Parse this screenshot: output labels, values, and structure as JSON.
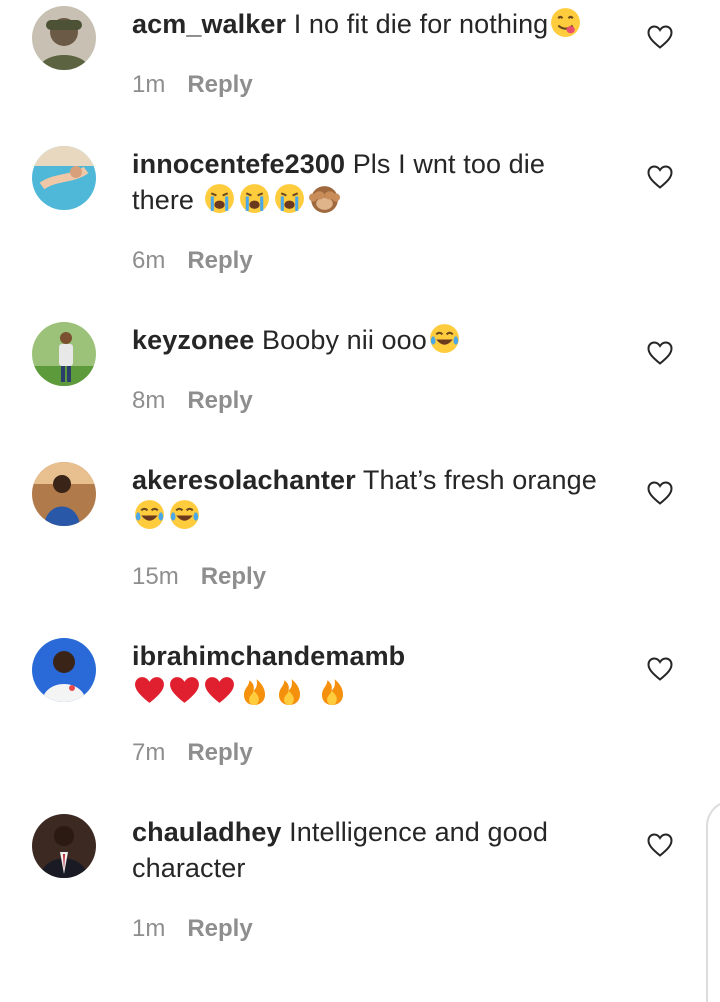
{
  "comments": [
    {
      "username": "acm_walker",
      "text": "I no fit die for nothing",
      "emojis": [
        "yum-emoji"
      ],
      "time": "1m",
      "reply_label": "Reply"
    },
    {
      "username": "innocentefe2300",
      "text": "Pls I wnt too die there",
      "emojis": [
        "loudly-crying-emoji",
        "loudly-crying-emoji",
        "loudly-crying-emoji",
        "see-no-evil-monkey-emoji"
      ],
      "time": "6m",
      "reply_label": "Reply"
    },
    {
      "username": "keyzonee",
      "text": "Booby nii ooo",
      "emojis": [
        "tears-of-joy-emoji"
      ],
      "time": "8m",
      "reply_label": "Reply"
    },
    {
      "username": "akeresolachanter",
      "text": "That’s fresh orange",
      "emojis": [
        "tears-of-joy-emoji",
        "tears-of-joy-emoji"
      ],
      "time": "15m",
      "reply_label": "Reply"
    },
    {
      "username": "ibrahimchandemamb",
      "text": "",
      "emojis": [
        "red-heart-emoji",
        "red-heart-emoji",
        "red-heart-emoji",
        "fire-emoji",
        "fire-emoji",
        "fire-emoji"
      ],
      "time": "7m",
      "reply_label": "Reply"
    },
    {
      "username": "chauladhey",
      "text": "Intelligence and good character",
      "emojis": [],
      "time": "1m",
      "reply_label": "Reply"
    }
  ],
  "icons": {
    "like": "heart-outline-icon"
  },
  "colors": {
    "text": "#262626",
    "meta": "#8e8e8e",
    "background": "#ffffff"
  }
}
